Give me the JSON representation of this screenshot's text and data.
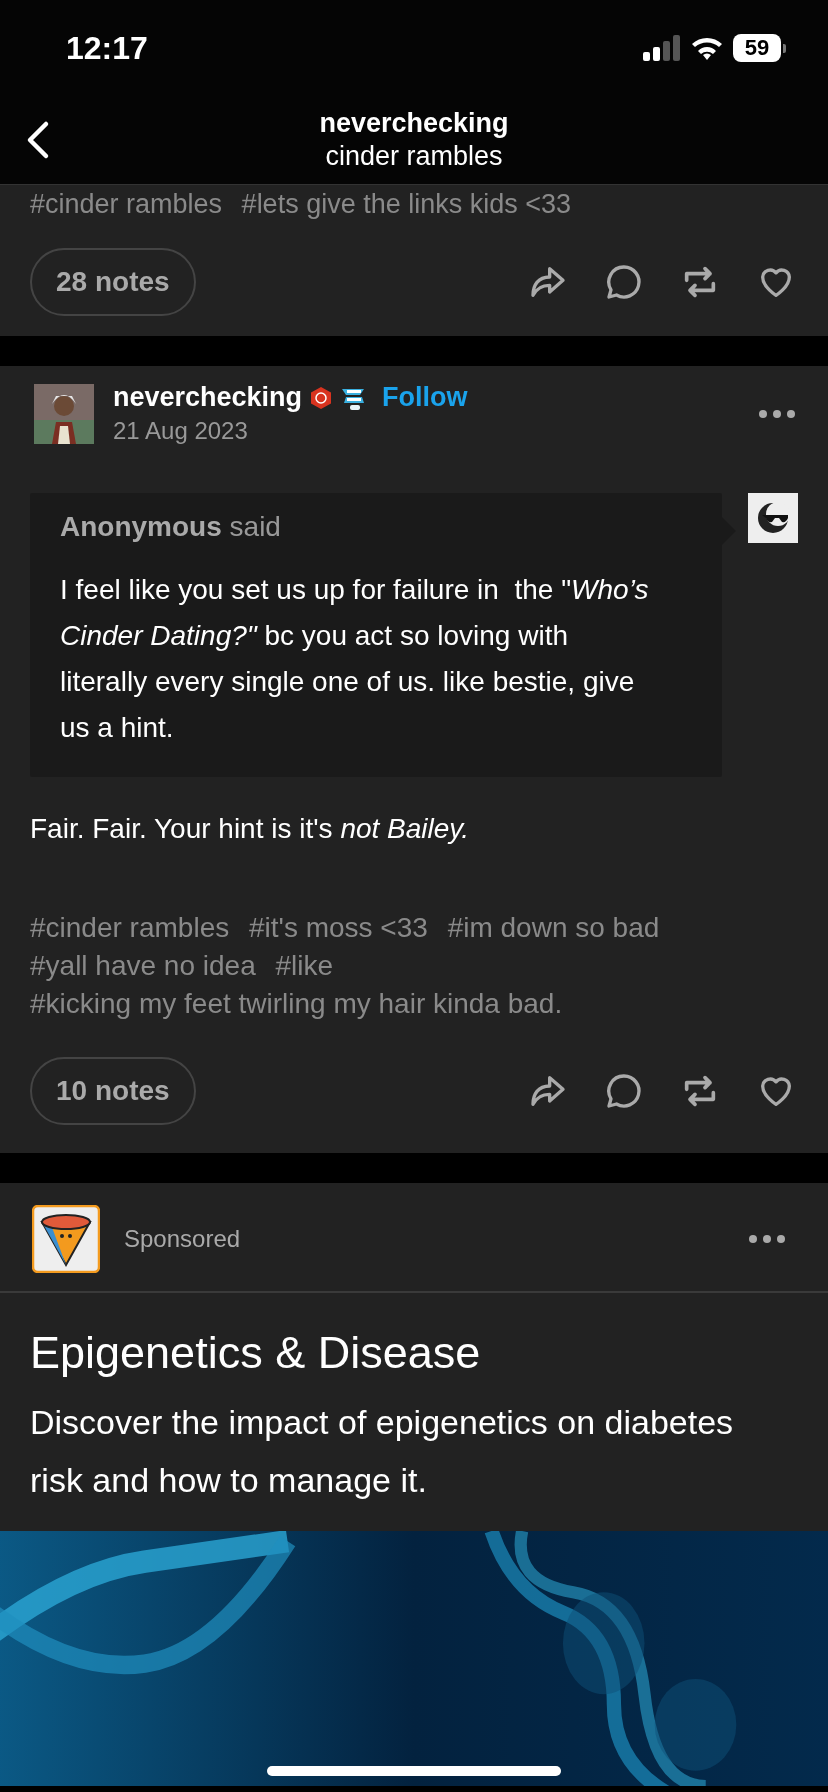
{
  "status_bar": {
    "time": "12:17",
    "battery": "59"
  },
  "header": {
    "title": "neverchecking",
    "subtitle": "cinder rambles"
  },
  "previous_post": {
    "tags": [
      "#cinder rambles",
      "#lets give the links kids <33"
    ],
    "notes": "28 notes"
  },
  "post": {
    "author": "neverchecking",
    "follow": "Follow",
    "date": "21 Aug 2023",
    "ask": {
      "asker": "Anonymous",
      "said": "said",
      "question": "I feel like you set us up for failure in  the \"*Who’s Cinder Dating?\"* bc you act so loving with literally every single one of us. like bestie, give us a hint."
    },
    "answer": "Fair. Fair. Your hint is it's *not Bailey.*",
    "tags": [
      "#cinder rambles",
      "#it's moss <33",
      "#im down so bad",
      "#yall have no idea",
      "#like",
      "#kicking my feet twirling my hair kinda bad."
    ],
    "notes": "10 notes"
  },
  "ad": {
    "label": "Sponsored",
    "title": "Epigenetics & Disease",
    "description": "Discover the impact of epigenetics on diabetes risk and how to manage it."
  }
}
